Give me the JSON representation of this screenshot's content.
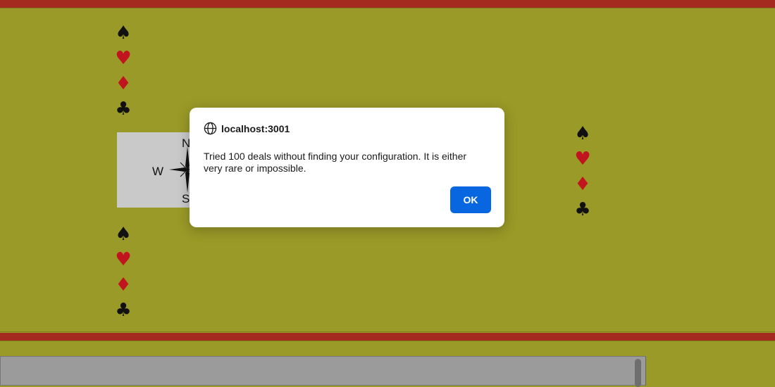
{
  "west_hand": {
    "suits": [
      "♠",
      "♥",
      "♦",
      "♣"
    ]
  },
  "south_hand": {
    "suits": [
      "♠",
      "♥",
      "♦",
      "♣"
    ]
  },
  "east_hand": {
    "suits": [
      "♠",
      "♥",
      "♦",
      "♣"
    ]
  },
  "compass": {
    "north": "N",
    "west": "W",
    "south": "S"
  },
  "dialog": {
    "origin": "localhost:3001",
    "message": "Tried 100 deals without finding your configuration. It is either very rare or impossible.",
    "ok_label": "OK"
  },
  "colors": {
    "table": "#9a9a28",
    "bar": "#a42a1f",
    "ok_button": "#0866e0",
    "red_suit": "#c0141e"
  }
}
